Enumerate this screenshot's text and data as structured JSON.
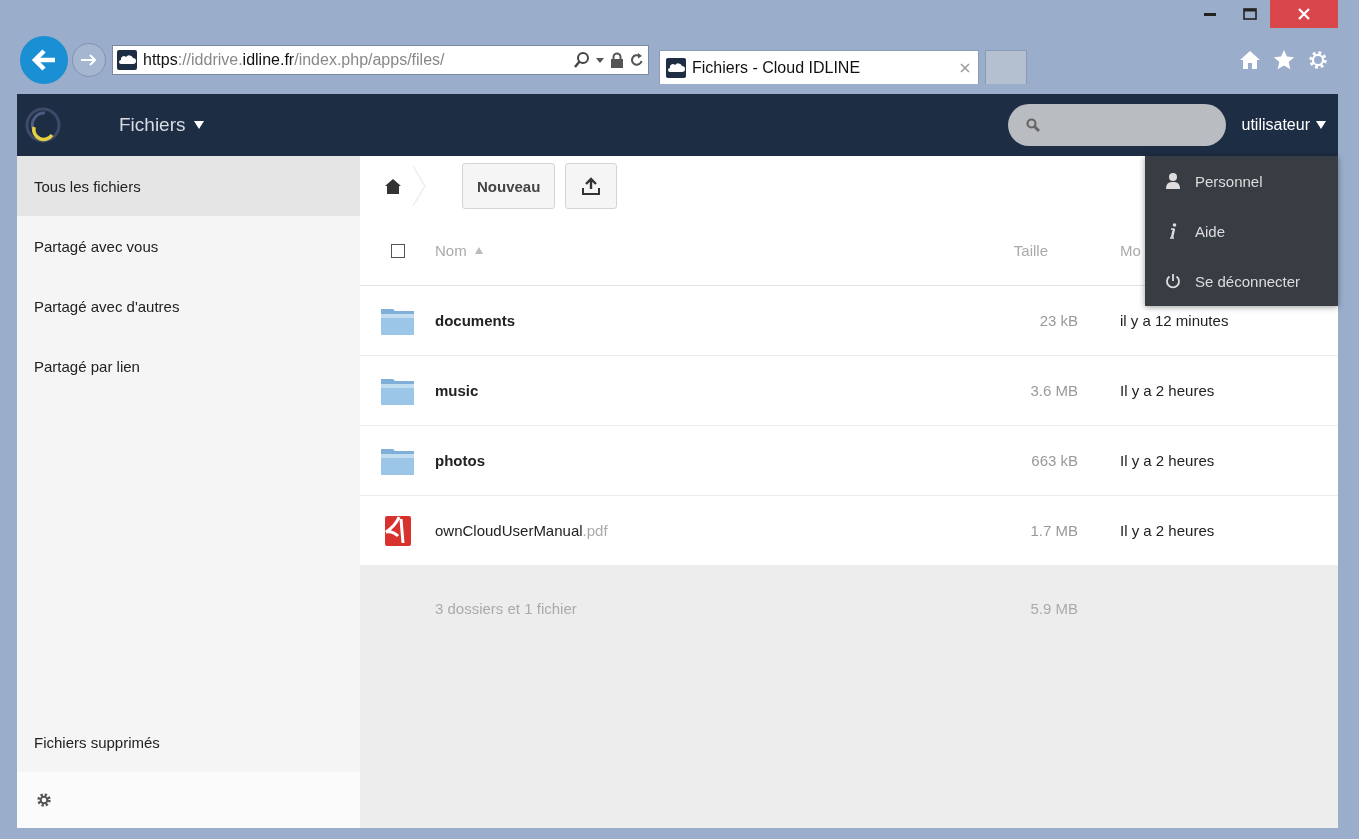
{
  "browser": {
    "url": {
      "scheme": "https",
      "host_prefix": "://iddrive.",
      "domain": "idline.fr",
      "path": "/index.php/apps/files/"
    },
    "tab": {
      "title": "Fichiers - Cloud IDLINE"
    }
  },
  "header": {
    "app_title": "Fichiers",
    "user": "utilisateur"
  },
  "sidebar": {
    "items": [
      {
        "label": "Tous les fichiers",
        "selected": true
      },
      {
        "label": "Partagé avec vous",
        "selected": false
      },
      {
        "label": "Partagé avec d'autres",
        "selected": false
      },
      {
        "label": "Partagé par lien",
        "selected": false
      }
    ],
    "trash": "Fichiers supprimés"
  },
  "toolbar": {
    "new_button": "Nouveau"
  },
  "table": {
    "select_all": {
      "checked": false
    },
    "columns": [
      {
        "label": "Nom",
        "sorted": true
      },
      {
        "label": "Taille",
        "sorted": false
      },
      {
        "label": "Mo",
        "sorted": false
      }
    ],
    "rows": [
      {
        "kind": "folder",
        "name": "documents",
        "size": "23 kB",
        "modified": "il y a 12 minutes"
      },
      {
        "kind": "folder",
        "name": "music",
        "size": "3.6 MB",
        "modified": "Il y a 2 heures"
      },
      {
        "kind": "folder",
        "name": "photos",
        "size": "663 kB",
        "modified": "Il y a 2 heures"
      },
      {
        "kind": "pdf",
        "name": "ownCloudUserManual",
        "extension": ".pdf",
        "size": "1.7 MB",
        "modified": "Il y a 2 heures"
      }
    ],
    "summary": {
      "count": "3 dossiers et 1 fichier",
      "size": "5.9 MB"
    }
  },
  "user_menu": {
    "items": [
      {
        "kind": "person",
        "label": "Personnel"
      },
      {
        "kind": "info",
        "label": "Aide"
      },
      {
        "kind": "power",
        "label": "Se déconnecter"
      }
    ]
  }
}
